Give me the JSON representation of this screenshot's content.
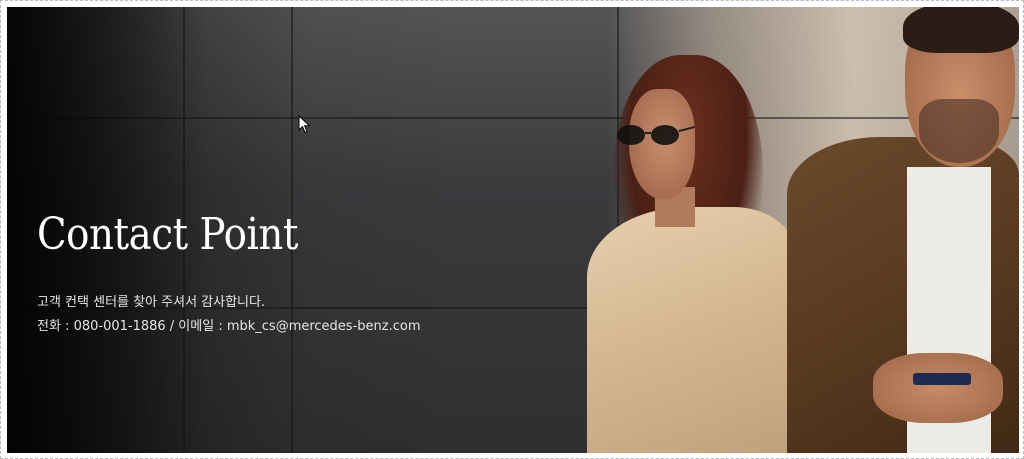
{
  "hero": {
    "title": "Contact Point",
    "greeting": "고객 컨택 센터를 찾아 주셔서 감사합니다.",
    "contact_line": "전화 : 080-001-1886 / 이메일 : mbk_cs@mercedes-benz.com"
  },
  "icons": {
    "cursor": "mouse-pointer-icon",
    "sunglasses": "sunglasses-icon",
    "phone": "smartphone-icon"
  },
  "colors": {
    "title_text": "#ffffff",
    "body_text": "#e6e6e6",
    "background_dark": "#2f2f31"
  }
}
